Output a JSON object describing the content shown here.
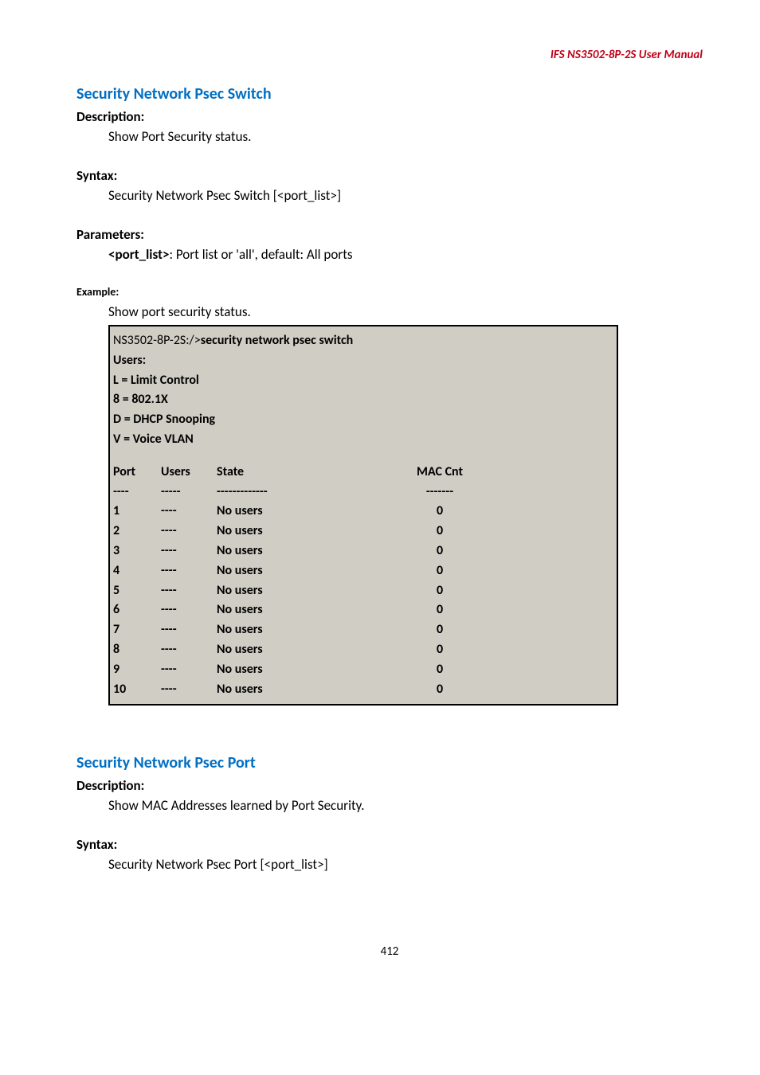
{
  "header": "IFS  NS3502-8P-2S  User  Manual",
  "section1": {
    "title": "Security Network Psec Switch",
    "description_label": "Description:",
    "description_text": "Show Port Security status.",
    "syntax_label": "Syntax:",
    "syntax_text": "Security Network Psec Switch [<port_list>]",
    "parameters_label": "Parameters:",
    "parameters_key": "<port_list>",
    "parameters_rest": ": Port list or 'all', default: All ports",
    "example_label": "Example:",
    "example_text": "Show port security status."
  },
  "cmdbox": {
    "prompt": "NS3502-8P-2S:/>",
    "command": "security network psec switch",
    "users_label": "Users:",
    "legend": [
      "L = Limit Control",
      "8 = 802.1X",
      "D = DHCP Snooping",
      "V = Voice VLAN"
    ],
    "headers": {
      "port": "Port",
      "users": "Users",
      "state": "State",
      "mac": "MAC Cnt"
    },
    "divider": {
      "port": "----",
      "users": "-----",
      "state": "-------------",
      "mac": "-------"
    },
    "rows": [
      {
        "port": "1",
        "users": "----",
        "state": "No users",
        "mac": "0"
      },
      {
        "port": "2",
        "users": "----",
        "state": "No users",
        "mac": "0"
      },
      {
        "port": "3",
        "users": "----",
        "state": "No users",
        "mac": "0"
      },
      {
        "port": "4",
        "users": "----",
        "state": "No users",
        "mac": "0"
      },
      {
        "port": "5",
        "users": "----",
        "state": "No users",
        "mac": "0"
      },
      {
        "port": "6",
        "users": "----",
        "state": "No users",
        "mac": "0"
      },
      {
        "port": "7",
        "users": "----",
        "state": "No users",
        "mac": "0"
      },
      {
        "port": "8",
        "users": "----",
        "state": "No users",
        "mac": "0"
      },
      {
        "port": "9",
        "users": "----",
        "state": "No users",
        "mac": "0"
      },
      {
        "port": "10",
        "users": "----",
        "state": "No users",
        "mac": "0"
      }
    ]
  },
  "section2": {
    "title": "Security Network Psec Port",
    "description_label": "Description:",
    "description_text": "Show MAC Addresses learned by Port Security.",
    "syntax_label": "Syntax:",
    "syntax_text": "Security Network Psec Port [<port_list>]"
  },
  "footer": "412"
}
